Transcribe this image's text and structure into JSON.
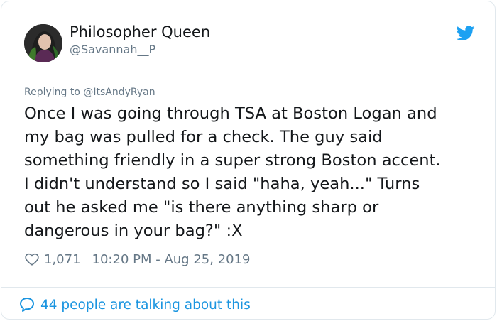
{
  "user": {
    "display_name": "Philosopher Queen",
    "handle": "@Savannah__P"
  },
  "tweet": {
    "reply_prefix": "Replying to ",
    "reply_to": "@ItsAndyRyan",
    "text": "Once I was going through TSA at Boston Logan and\nmy bag was pulled for a check. The guy said\nsomething friendly in a super strong Boston accent.\nI didn't understand so I said \"haha, yeah...\" Turns\nout he asked me \"is there anything sharp or\ndangerous in your bag?\" :X",
    "likes": "1,071",
    "timestamp": "10:20 PM - Aug 25, 2019"
  },
  "footer": {
    "talking": "44 people are talking about this"
  },
  "icons": {
    "brand": "twitter-bird-icon",
    "like": "heart-outline-icon",
    "conversation": "speech-bubble-icon"
  },
  "colors": {
    "accent": "#1b95e0",
    "brand": "#1da1f2",
    "secondary_text": "#657786",
    "border": "#e1e8ed"
  }
}
